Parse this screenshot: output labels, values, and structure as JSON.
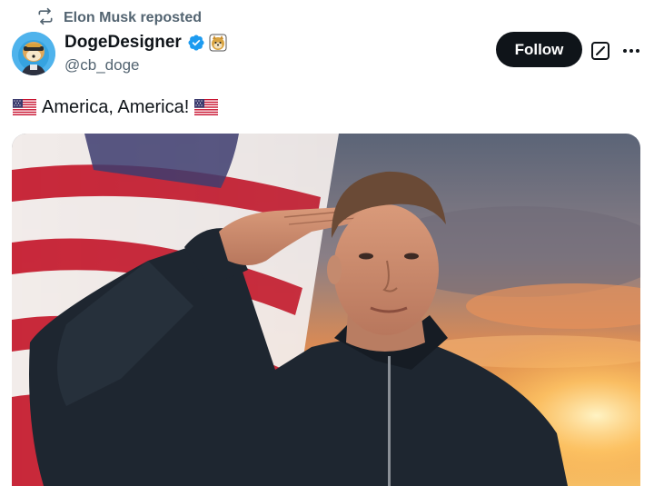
{
  "repost": {
    "label": "Elon Musk reposted",
    "icon": "repost-icon"
  },
  "author": {
    "display_name": "DogeDesigner",
    "handle": "@cb_doge",
    "verified": true,
    "verified_color": "#1d9bf0",
    "affiliate_badge": "doge-badge-icon"
  },
  "follow_button": {
    "label": "Follow"
  },
  "icons": {
    "grok": "grok-icon",
    "more": "more-icon"
  },
  "post": {
    "text": "America, America!",
    "emoji_prefix": "us-flag-emoji",
    "emoji_suffix": "us-flag-emoji"
  },
  "media": {
    "type": "photo",
    "subject": "person saluting in front of american flag at sunset"
  },
  "colors": {
    "text": "#0f1419",
    "secondary": "#536471",
    "button_bg": "#0f1419",
    "accent": "#1d9bf0"
  }
}
